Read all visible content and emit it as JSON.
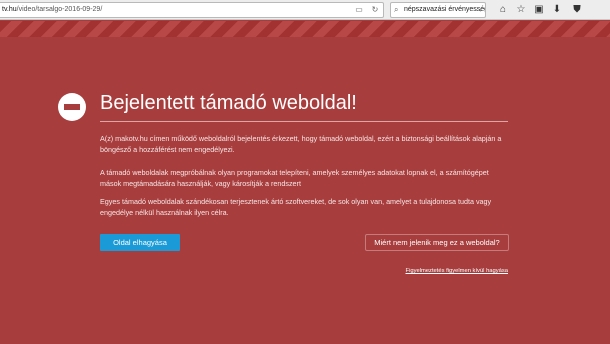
{
  "browser": {
    "url_host": "tv.hu",
    "url_path": "/video/tarsalgo-2016-09-29/",
    "search_value": "népszavazási érvényessége"
  },
  "warning": {
    "title": "Bejelentett támadó weboldal!",
    "paragraph1": "A(z) makotv.hu címen működő weboldalról bejelentés érkezett, hogy támadó weboldal, ezért a biztonsági beállítások alapján a böngésző a hozzáférést nem engedélyezi.",
    "paragraph2": "A támadó weboldalak megpróbálnak olyan programokat telepíteni, amelyek személyes adatokat lopnak el, a számítógépet mások megtámadására használják, vagy károsítják a rendszert",
    "paragraph3": "Egyes támadó weboldalak szándékosan terjesztenek ártó szoftvereket, de sok olyan van, amelyet a tulajdonosa tudta vagy engedélye nélkül használnak ilyen célra.",
    "leave_button": "Oldal elhagyása",
    "why_button": "Miért nem jelenik meg ez a weboldal?",
    "ignore_link": "Figyelmeztetés figyelmen kívül hagyása"
  },
  "colors": {
    "background": "#a83d3d",
    "leave_button": "#1a9ad6"
  },
  "icons": [
    "reader-view-icon",
    "reload-icon",
    "search-icon",
    "go-arrow-icon",
    "home-icon",
    "bookmark-star-icon",
    "clipboard-icon",
    "download-icon",
    "shield-icon"
  ]
}
